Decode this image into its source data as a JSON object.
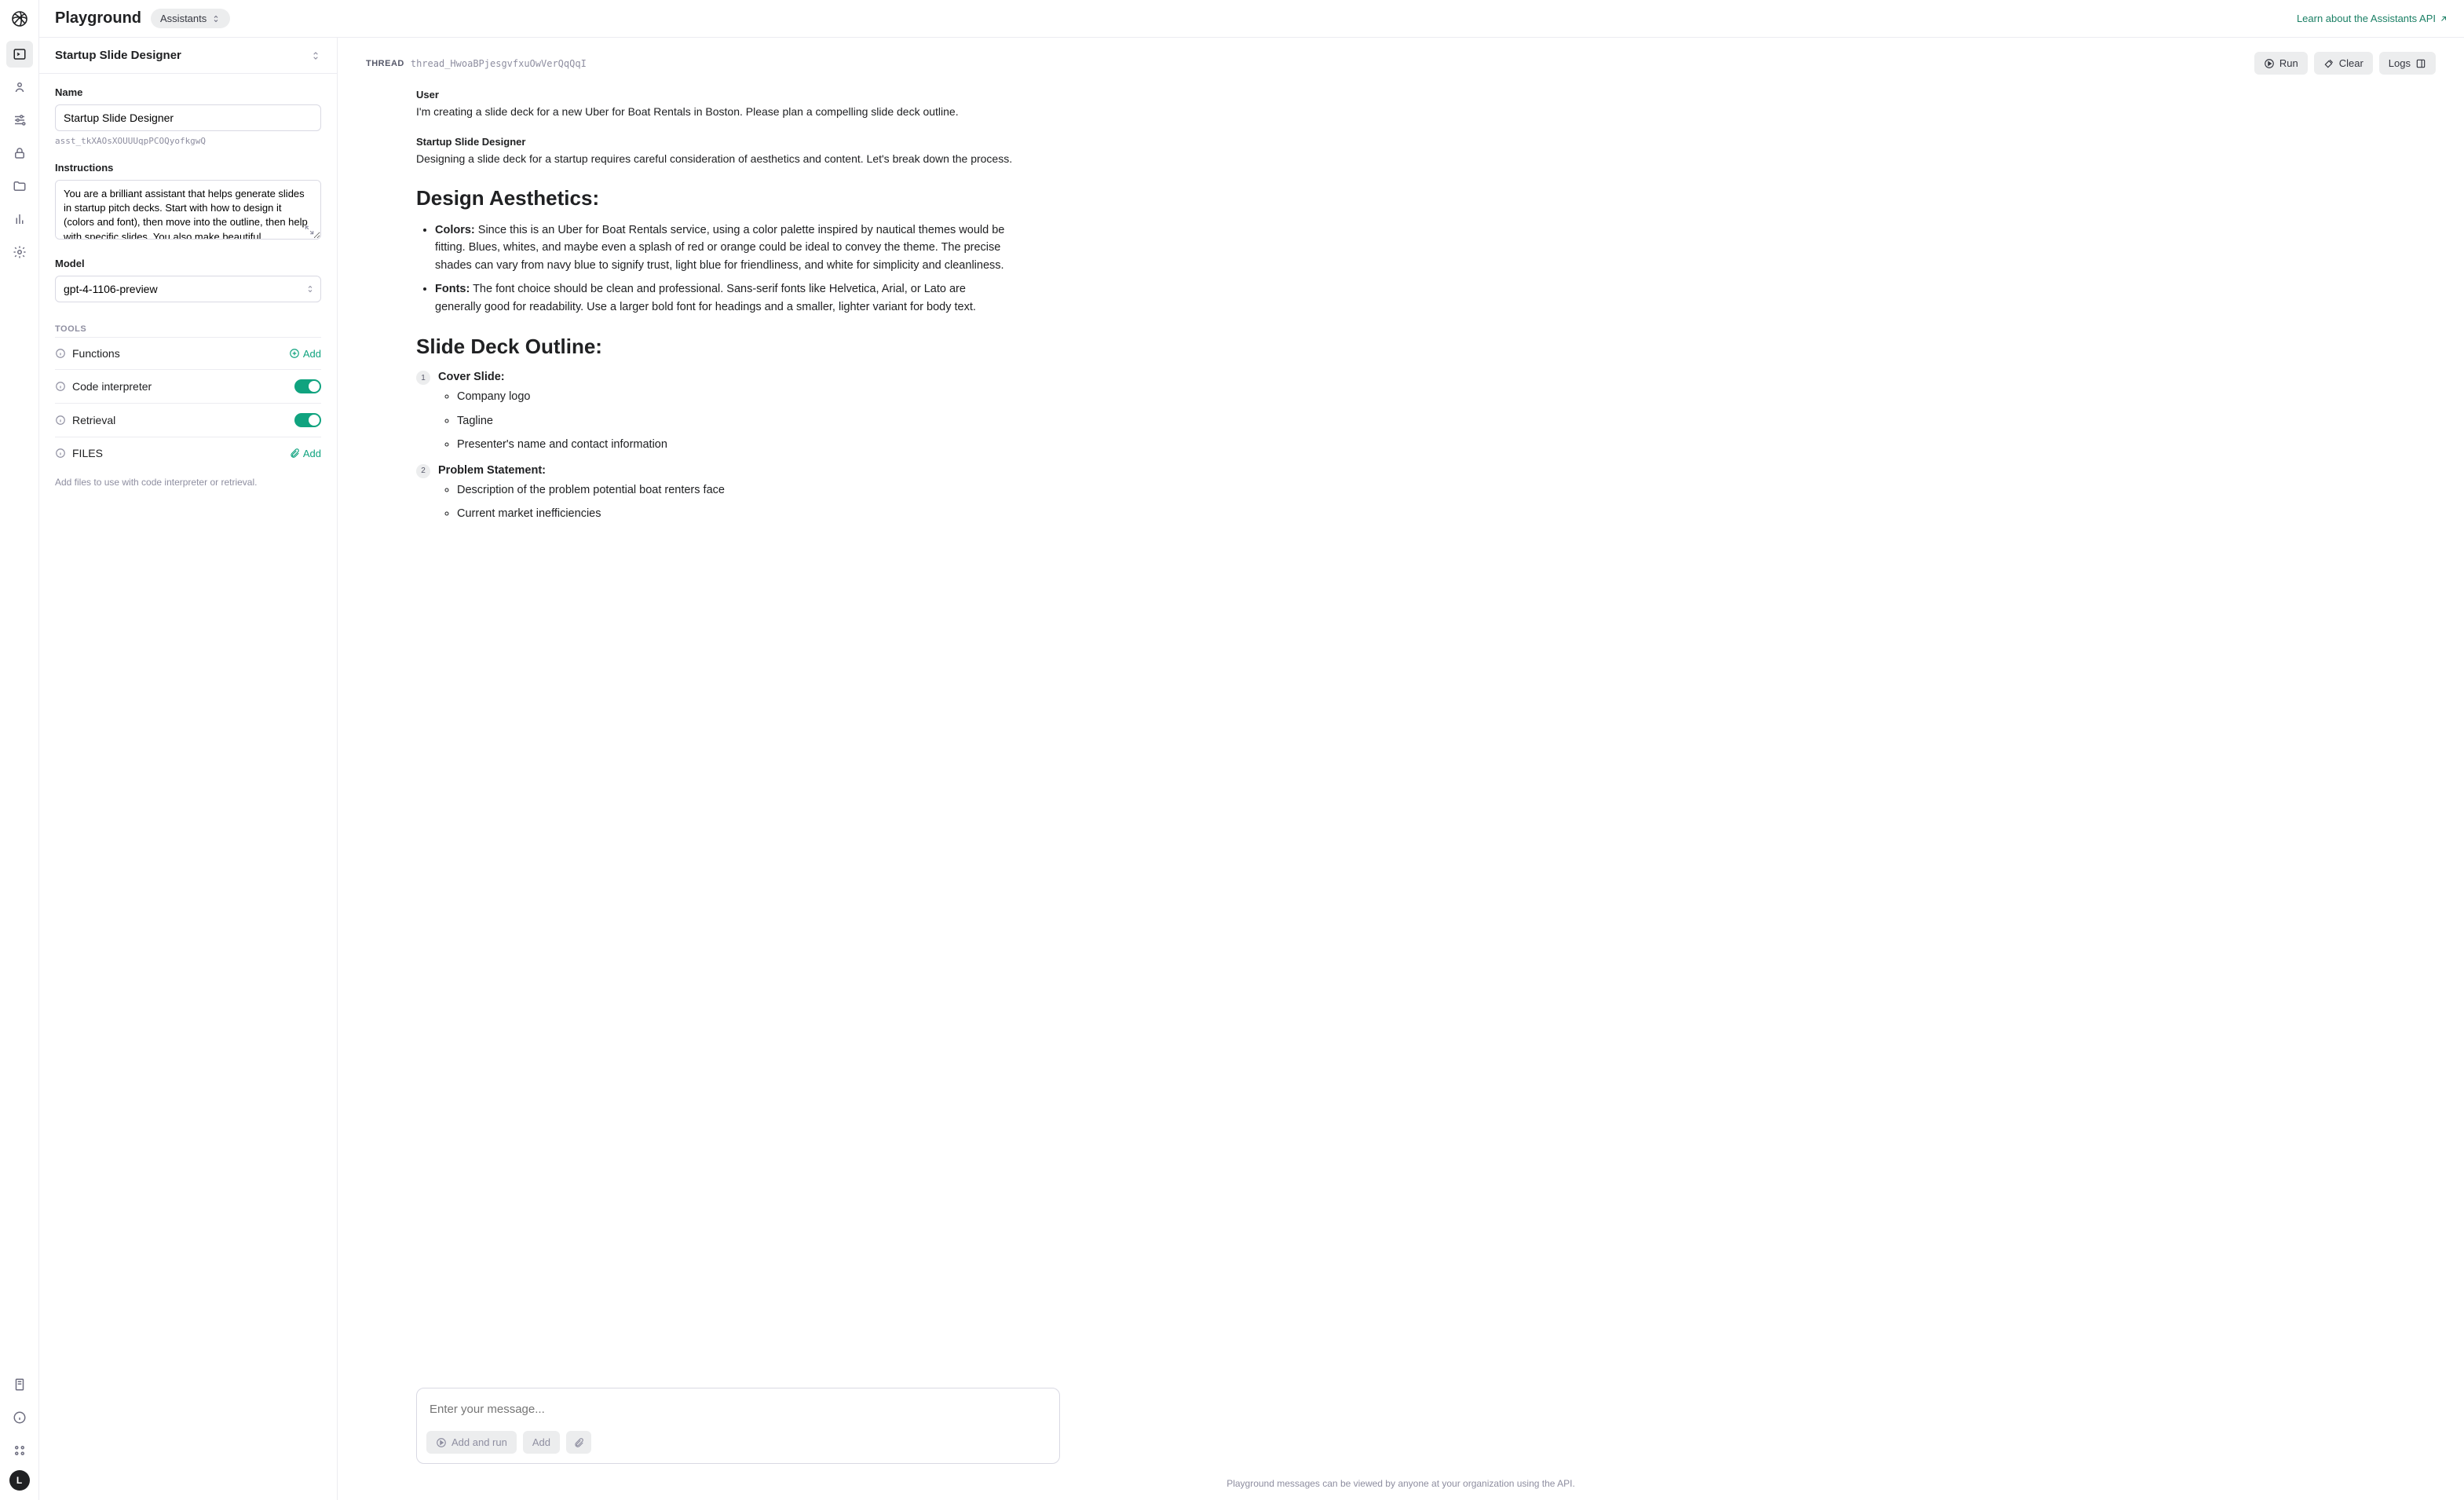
{
  "topbar": {
    "title": "Playground",
    "context_pill": "Assistants",
    "learn_link": "Learn about the Assistants API"
  },
  "rail": {
    "avatar_initial": "L"
  },
  "assistant": {
    "header_title": "Startup Slide Designer",
    "name_label": "Name",
    "name_value": "Startup Slide Designer",
    "id": "asst_tkXAOsXOUUUqpPCOQyofkgwQ",
    "instructions_label": "Instructions",
    "instructions_value": "You are a brilliant assistant that helps generate slides in startup pitch decks. Start with how to design it (colors and font), then move into the outline, then help with specific slides. You also make beautiful",
    "model_label": "Model",
    "model_value": "gpt-4-1106-preview",
    "tools_label": "TOOLS",
    "tools": {
      "functions": "Functions",
      "code_interpreter": "Code interpreter",
      "retrieval": "Retrieval"
    },
    "add_label": "Add",
    "files_label": "FILES",
    "files_hint": "Add files to use with code interpreter or retrieval."
  },
  "thread": {
    "label": "THREAD",
    "id": "thread_HwoaBPjesgvfxuOwVerQqQqI",
    "run_label": "Run",
    "clear_label": "Clear",
    "logs_label": "Logs"
  },
  "messages": {
    "user_role": "User",
    "user_text": "I'm creating a slide deck for a new Uber for Boat Rentals in Boston. Please plan a compelling slide deck outline.",
    "assistant_role": "Startup Slide Designer",
    "assistant_intro": "Designing a slide deck for a startup requires careful consideration of aesthetics and content. Let's break down the process.",
    "h_design": "Design Aesthetics:",
    "colors_label": "Colors:",
    "colors_text": " Since this is an Uber for Boat Rentals service, using a color palette inspired by nautical themes would be fitting. Blues, whites, and maybe even a splash of red or orange could be ideal to convey the theme. The precise shades can vary from navy blue to signify trust, light blue for friendliness, and white for simplicity and cleanliness.",
    "fonts_label": "Fonts:",
    "fonts_text": " The font choice should be clean and professional. Sans-serif fonts like Helvetica, Arial, or Lato are generally good for readability. Use a larger bold font for headings and a smaller, lighter variant for body text.",
    "h_outline": "Slide Deck Outline:",
    "outline": [
      {
        "title": "Cover Slide:",
        "items": [
          "Company logo",
          "Tagline",
          "Presenter's name and contact information"
        ]
      },
      {
        "title": "Problem Statement:",
        "items": [
          "Description of the problem potential boat renters face",
          "Current market inefficiencies"
        ]
      }
    ]
  },
  "composer": {
    "placeholder": "Enter your message...",
    "add_and_run": "Add and run",
    "add": "Add"
  },
  "footer": {
    "note": "Playground messages can be viewed by anyone at your organization using the API."
  }
}
